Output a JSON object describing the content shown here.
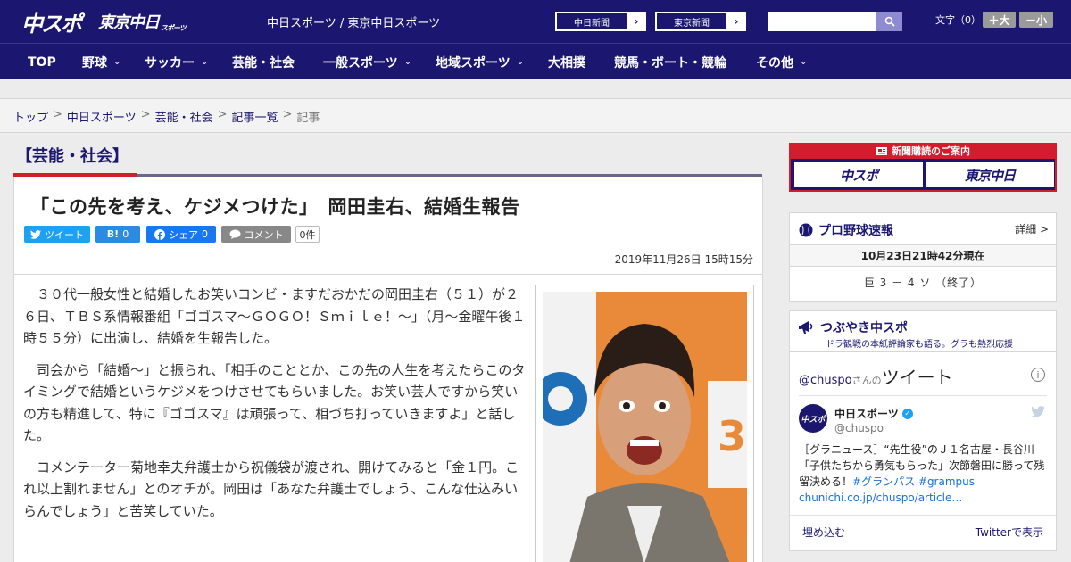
{
  "header": {
    "logo_chuspo": "中スポ",
    "logo_tokyo": "東京中日",
    "logo_tokyo_small": "スポーツ",
    "site_names": "中日スポーツ / 東京中日スポーツ",
    "paper_buttons": [
      {
        "label": "中日新聞",
        "arrow": "›"
      },
      {
        "label": "東京新聞",
        "arrow": "›"
      }
    ],
    "search_placeholder": "",
    "fontsize_label": "文字（0）",
    "fontsize_plus": "＋大",
    "fontsize_minus": "－小"
  },
  "nav": {
    "items": [
      {
        "label": "TOP",
        "has_menu": false
      },
      {
        "label": "野球",
        "has_menu": true
      },
      {
        "label": "サッカー",
        "has_menu": true
      },
      {
        "label": "芸能・社会",
        "has_menu": false
      },
      {
        "label": "一般スポーツ",
        "has_menu": true
      },
      {
        "label": "地域スポーツ",
        "has_menu": true
      },
      {
        "label": "大相撲",
        "has_menu": false
      },
      {
        "label": "競馬・ボート・競輪",
        "has_menu": false
      },
      {
        "label": "その他",
        "has_menu": true
      }
    ],
    "chevron": "⌄"
  },
  "breadcrumb": {
    "items": [
      "トップ",
      "中日スポーツ",
      "芸能・社会",
      "記事一覧",
      "記事"
    ],
    "separator": ">"
  },
  "article": {
    "section": "【芸能・社会】",
    "headline": "「この先を考え、ケジメつけた」　岡田圭右、結婚生報告",
    "share": {
      "tweet": "ツイート",
      "hatena_icon": "B!",
      "hatena_count": "0",
      "facebook": "シェア",
      "facebook_count": "0",
      "comment": "コメント",
      "comment_count": "0件"
    },
    "date": "2019年11月26日 15時15分",
    "paragraphs": [
      "３０代一般女性と結婚したお笑いコンビ・ますだおかだの岡田圭右（５１）が２６日、ＴＢＳ系情報番組「ゴゴスマ～ＧＯＧＯ！Ｓｍｉｌｅ！～」（月～金曜午後１時５５分）に出演し、結婚を生報告した。",
      "司会から「結婚～」と振られ、「相手のこととか、この先の人生を考えたらこのタイミングで結婚というケジメをつけさせてもらいました。お笑い芸人ですから笑いの方も精進して、特に『ゴゴスマ』は頑張って、相づち打っていきますよ」と話した。",
      "コメンテーター菊地幸夫弁護士から祝儀袋が渡され、開けてみると「金１円。これ以上割れません」とのオチが。岡田は「あなた弁護士でしょう、こんな仕込みいらんでしょう」と苦笑していた。"
    ]
  },
  "sidebar": {
    "subscribe": {
      "title": "新聞購読のご案内",
      "btn1": "中スポ",
      "btn2": "東京中日"
    },
    "baseball": {
      "title": "プロ野球速報",
      "more": "詳細 >",
      "time": "10月23日21時42分現在",
      "score": "巨 3 － 4 ソ （終了）"
    },
    "tweets": {
      "title": "つぶやき中スポ",
      "subtitle": "ドラ観戦の本紙評論家も語る。グラも熱烈応援",
      "handle": "@chuspo",
      "handle_suffix": "さんの",
      "tweets_label": "ツイート",
      "info": "i",
      "avatar_text": "中スポ",
      "name": "中日スポーツ",
      "verified": "✓",
      "at": "@chuspo",
      "text": "［グラニュース］“先生役”のＪ１名古屋・長谷川「子供たちから勇気もらった」次節磐田に勝って残留決める！",
      "hashtags": "#グランパス #grampus",
      "link": "chunichi.co.jp/chuspo/article…",
      "embed": "埋め込む",
      "view": "Twitterで表示"
    }
  }
}
